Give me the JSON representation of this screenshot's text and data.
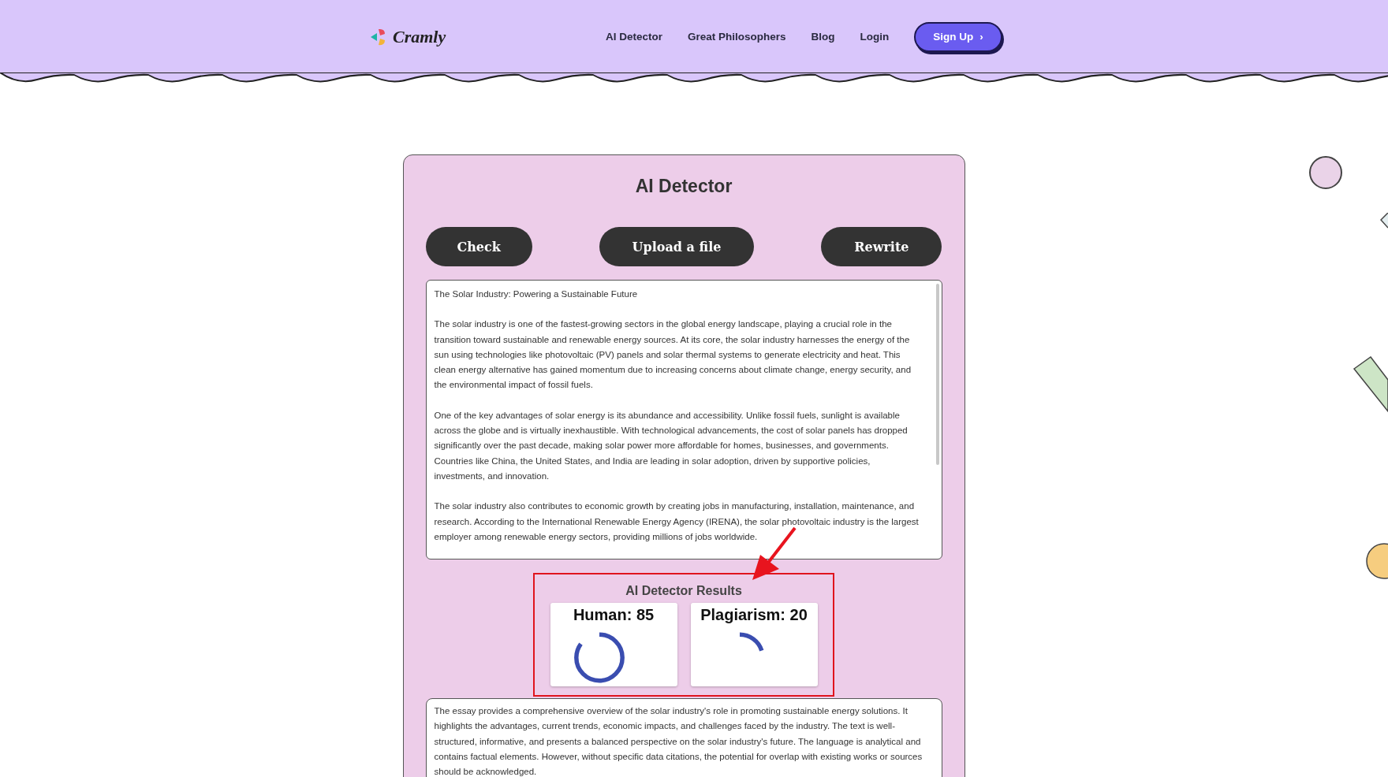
{
  "header": {
    "logo": "Cramly",
    "nav": [
      {
        "label": "AI Detector"
      },
      {
        "label": "Great Philosophers"
      },
      {
        "label": "Blog"
      },
      {
        "label": "Login"
      }
    ],
    "signup": {
      "label": "Sign Up",
      "caret": "›"
    }
  },
  "detector": {
    "title": "AI Detector",
    "buttons": [
      {
        "label": "Check"
      },
      {
        "label": "Upload a file"
      },
      {
        "label": "Rewrite"
      }
    ],
    "essay": [
      "The Solar Industry: Powering a Sustainable Future",
      "The solar industry is one of the fastest-growing sectors in the global energy landscape, playing a crucial role in the transition toward sustainable and renewable energy sources. At its core, the solar industry harnesses the energy of the sun using technologies like photovoltaic (PV) panels and solar thermal systems to generate electricity and heat. This clean energy alternative has gained momentum due to increasing concerns about climate change, energy security, and the environmental impact of fossil fuels.",
      "One of the key advantages of solar energy is its abundance and accessibility. Unlike fossil fuels, sunlight is available across the globe and is virtually inexhaustible. With technological advancements, the cost of solar panels has dropped significantly over the past decade, making solar power more affordable for homes, businesses, and governments. Countries like China, the United States, and India are leading in solar adoption, driven by supportive policies, investments, and innovation.",
      "The solar industry also contributes to economic growth by creating jobs in manufacturing, installation, maintenance, and research. According to the International Renewable Energy Agency (IRENA), the solar photovoltaic industry is the largest employer among renewable energy sectors, providing millions of jobs worldwide."
    ],
    "results": {
      "title": "AI Detector Results",
      "scores": [
        {
          "label": "Human: 85",
          "level": 0.85
        },
        {
          "label": "Plagiarism: 20",
          "level": 0.2
        }
      ]
    },
    "summary": "The essay provides a comprehensive overview of the solar industry's role in promoting sustainable energy solutions. It highlights the advantages, current trends, economic impacts, and challenges faced by the industry. The text is well-structured, informative, and presents a balanced perspective on the solar industry's future. The language is analytical and contains factual elements. However, without specific data citations, the potential for overlap with existing works or sources should be acknowledged."
  }
}
